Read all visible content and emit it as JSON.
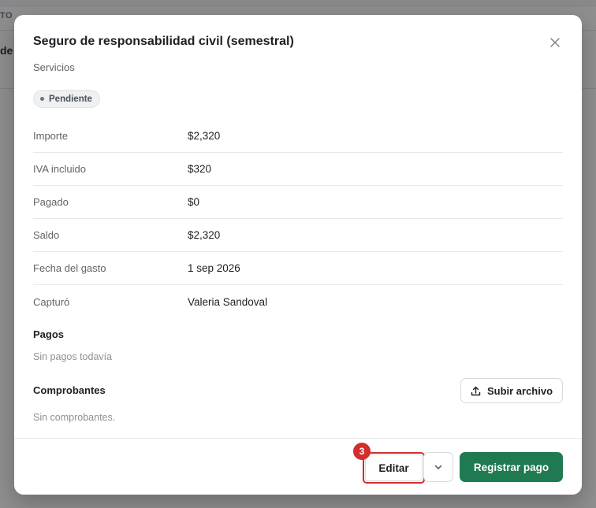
{
  "background": {
    "column_header_fragment": "TO",
    "row_text_fragment": "de"
  },
  "modal": {
    "title": "Seguro de responsabilidad civil (semestral)",
    "category": "Servicios",
    "status_badge": "Pendiente",
    "details": [
      {
        "label": "Importe",
        "value": "$2,320"
      },
      {
        "label": "IVA incluido",
        "value": "$320"
      },
      {
        "label": "Pagado",
        "value": "$0"
      },
      {
        "label": "Saldo",
        "value": "$2,320"
      },
      {
        "label": "Fecha del gasto",
        "value": "1 sep 2026"
      },
      {
        "label": "Capturó",
        "value": "Valeria Sandoval"
      }
    ],
    "payments": {
      "title": "Pagos",
      "empty": "Sin pagos todavía"
    },
    "receipts": {
      "title": "Comprobantes",
      "upload_label": "Subir archivo",
      "empty": "Sin comprobantes."
    },
    "footer": {
      "edit_label": "Editar",
      "step_number": "3",
      "register_payment_label": "Registrar pago"
    }
  },
  "icons": {
    "close": "close-icon",
    "upload": "upload-icon",
    "more": "chevron-down-icon"
  },
  "colors": {
    "primary": "#1f7a52",
    "highlight": "#d12e2e",
    "badge_bg": "#eef0f2"
  }
}
